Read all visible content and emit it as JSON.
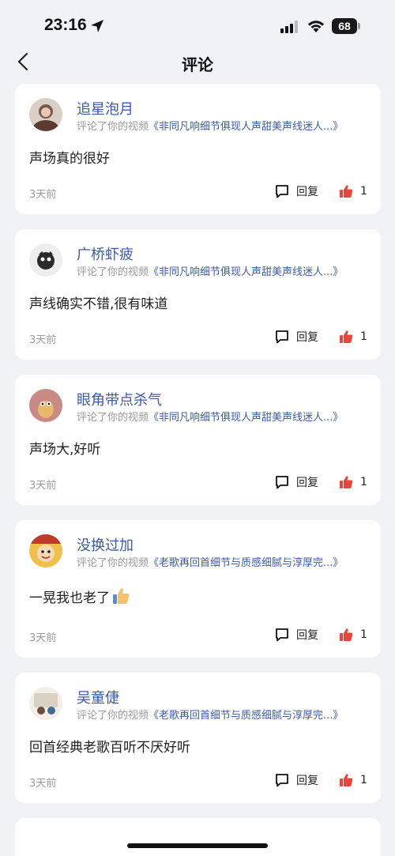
{
  "status_bar": {
    "time": "23:16",
    "battery": "68",
    "icons": [
      "location-arrow-icon",
      "signal-icon",
      "wifi-icon",
      "battery-icon"
    ]
  },
  "nav": {
    "title": "评论",
    "back_icon": "chevron-left-icon"
  },
  "comments": [
    {
      "user": "追星泡月",
      "action": "评论了你的视频",
      "video_title": "《非同凡响细节俱现人声甜美声线迷人...》",
      "text": "声场真的很好",
      "time": "3天前",
      "reply_label": "回复",
      "likes": "1"
    },
    {
      "user": "广桥虾疲",
      "action": "评论了你的视频",
      "video_title": "《非同凡响细节俱现人声甜美声线迷人...》",
      "text": "声线确实不错,很有味道",
      "time": "3天前",
      "reply_label": "回复",
      "likes": "1"
    },
    {
      "user": "眼角带点杀气",
      "action": "评论了你的视频",
      "video_title": "《非同凡响细节俱现人声甜美声线迷人...》",
      "text": "声场大,好听",
      "time": "3天前",
      "reply_label": "回复",
      "likes": "1"
    },
    {
      "user": "没换过加",
      "action": "评论了你的视频",
      "video_title": "《老歌再回首细节与质感细腻与淳厚完...》",
      "text": "一晃我也老了",
      "text_emoji": "thumbs-up-emoji",
      "time": "3天前",
      "reply_label": "回复",
      "likes": "1"
    },
    {
      "user": "吴童倢",
      "action": "评论了你的视频",
      "video_title": "《老歌再回首细节与质感细腻与淳厚完...》",
      "text": "回首经典老歌百听不厌好听",
      "time": "3天前",
      "reply_label": "回复",
      "likes": "1"
    }
  ],
  "colors": {
    "background": "#f1f2f6",
    "link": "#3b5aa8",
    "like": "#e8453c",
    "muted": "#9b9b9b"
  }
}
